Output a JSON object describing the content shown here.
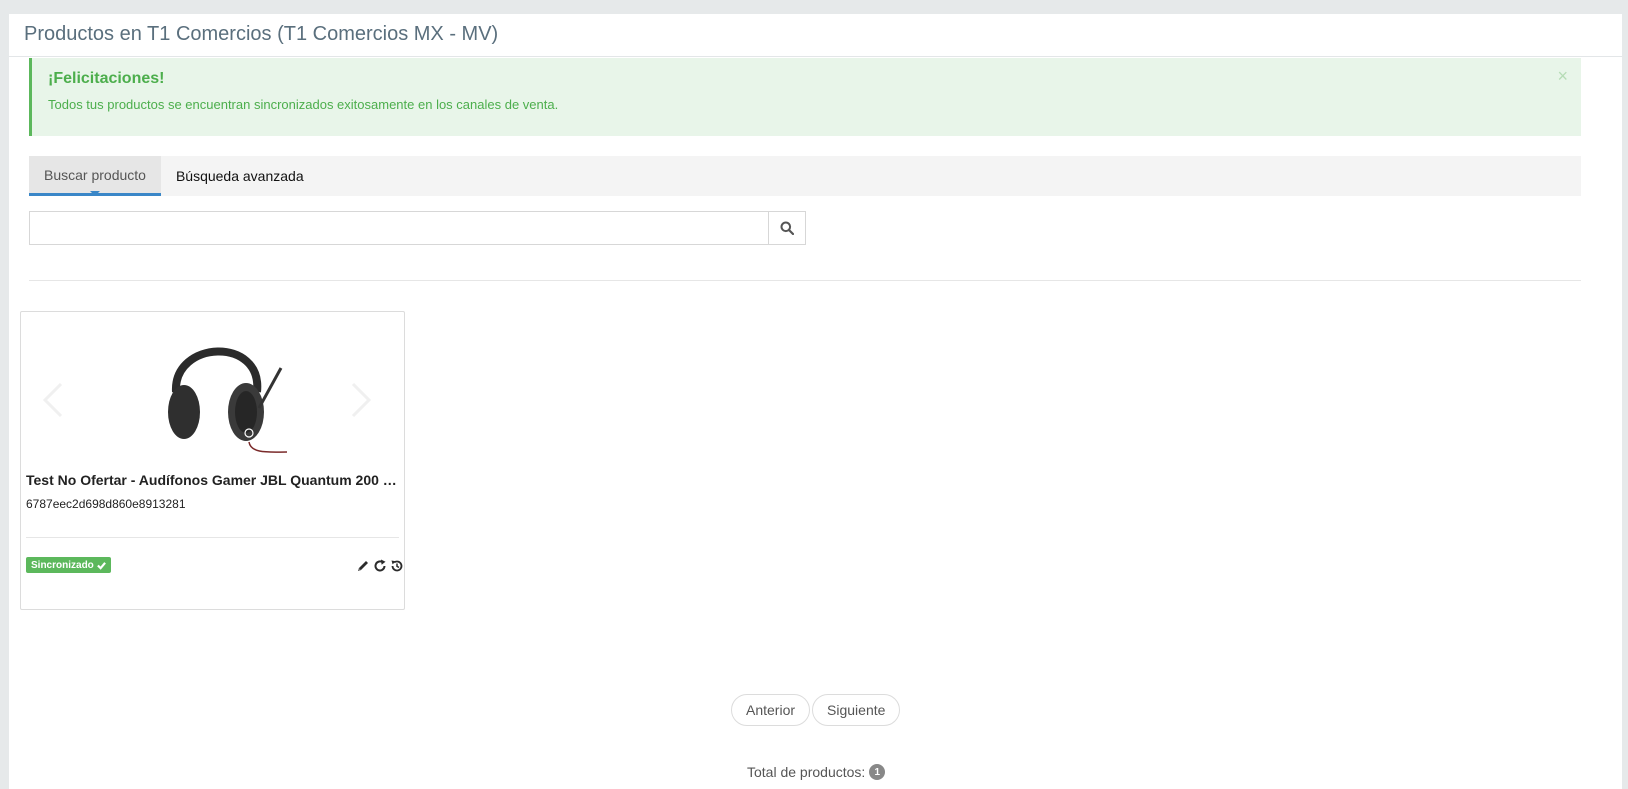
{
  "header": {
    "title": "Productos en T1 Comercios (T1 Comercios MX - MV)"
  },
  "alert": {
    "title": "¡Felicitaciones!",
    "message": "Todos tus productos se encuentran sincronizados exitosamente en los canales de venta.",
    "close": "×"
  },
  "tabs": [
    {
      "label": "Buscar producto",
      "active": true
    },
    {
      "label": "Búsqueda avanzada",
      "active": false
    }
  ],
  "search": {
    "value": "",
    "placeholder": ""
  },
  "products": [
    {
      "name": "Test No Ofertar - Audífonos Gamer JBL Quantum 200 …",
      "id": "6787eec2d698d860e8913281",
      "status": "Sincronizado",
      "status_color": "#5cb85c"
    }
  ],
  "pagination": {
    "prev": "Anterior",
    "next": "Siguiente"
  },
  "summary": {
    "label": "Total de productos:",
    "count": "1"
  },
  "colors": {
    "accent": "#3a87c8",
    "success": "#5cb85c",
    "alert_bg": "#e8f5e9"
  }
}
